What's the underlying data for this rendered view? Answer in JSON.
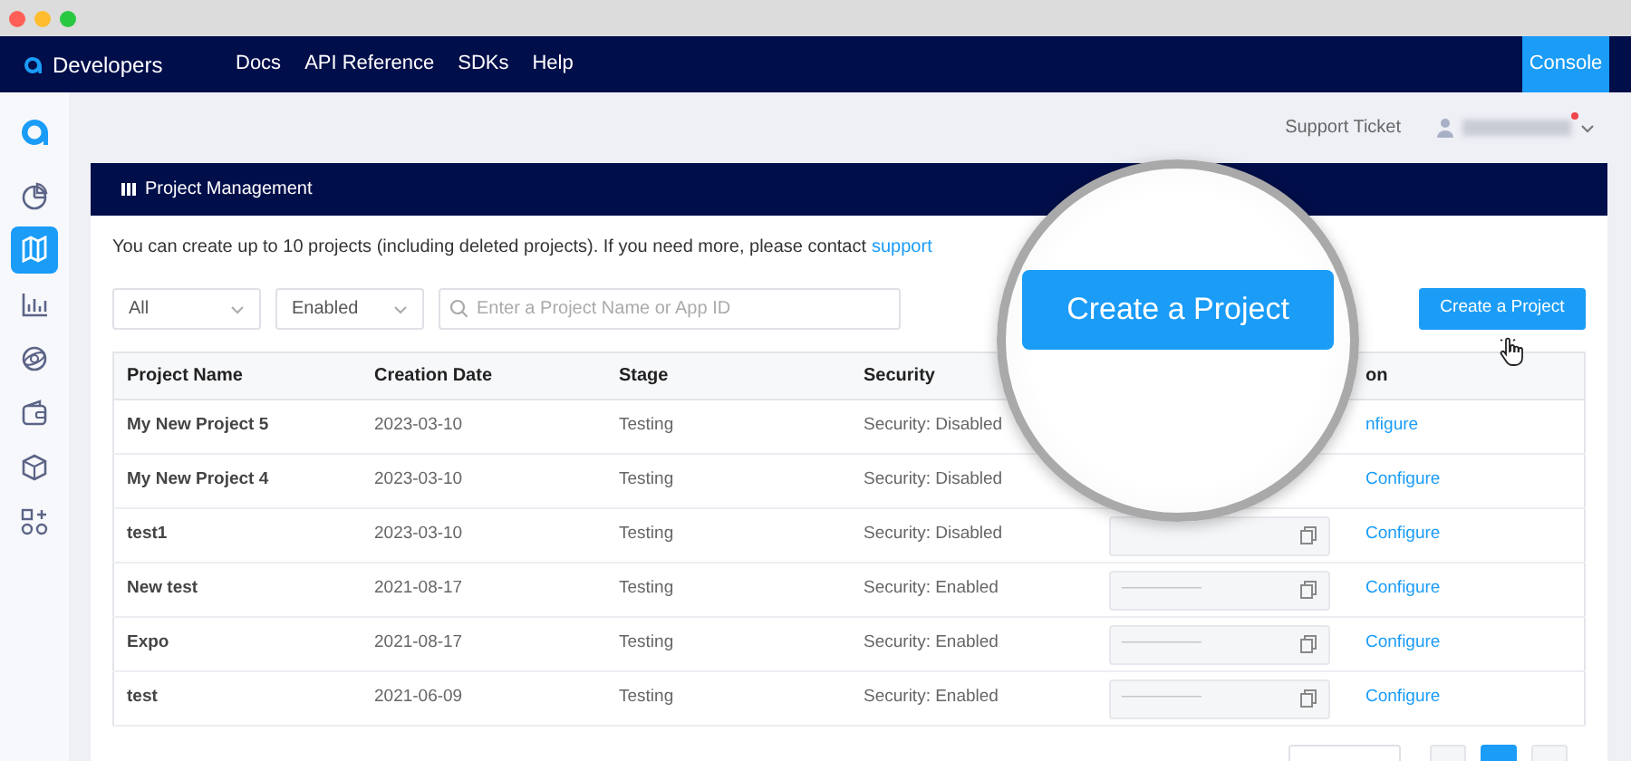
{
  "window": {
    "controls": [
      {
        "color": "#ff5f57"
      },
      {
        "color": "#febc2e"
      },
      {
        "color": "#28c840"
      }
    ]
  },
  "navbar": {
    "brand": "Developers",
    "links": [
      "Docs",
      "API Reference",
      "SDKs",
      "Help"
    ],
    "console": "Console"
  },
  "sidebar": {
    "items": [
      {
        "selected": false
      },
      {
        "selected": true
      },
      {
        "selected": false
      },
      {
        "selected": false
      },
      {
        "selected": false
      },
      {
        "selected": false
      },
      {
        "selected": false
      }
    ]
  },
  "topbar": {
    "support": "Support Ticket",
    "notification": true
  },
  "card": {
    "title": "Project Management",
    "notice": "You can create up to 10 projects (including deleted projects). If you need more, please contact",
    "notice_link": "support",
    "filters": [
      {
        "value": "All"
      },
      {
        "value": "Enabled"
      }
    ],
    "search": {
      "placeholder": "Enter a Project Name or App ID"
    },
    "create_button": "Create a Project",
    "table": {
      "columns": [
        "Project Name",
        "Creation Date",
        "Stage",
        "Security"
      ],
      "action_heading": "on",
      "rows": [
        {
          "name": "My New Project 5",
          "date": "2023-03-10",
          "stage": "Testing",
          "security": "Security: Disabled",
          "action": "nfigure"
        },
        {
          "name": "My New Project 4",
          "date": "2023-03-10",
          "stage": "Testing",
          "security": "Security: Disabled",
          "action": "Configure"
        },
        {
          "name": "test1",
          "date": "2023-03-10",
          "stage": "Testing",
          "security": "Security: Disabled",
          "app_id_field": true,
          "action": "Configure"
        },
        {
          "name": "New test",
          "date": "2021-08-17",
          "stage": "Testing",
          "security": "Security: Enabled",
          "app_id_field": true,
          "app_id": "------------------------------",
          "action": "Configure"
        },
        {
          "name": "Expo",
          "date": "2021-08-17",
          "stage": "Testing",
          "security": "Security: Enabled",
          "app_id_field": true,
          "app_id": "------------------------------",
          "action": "Configure"
        },
        {
          "name": "test",
          "date": "2021-06-09",
          "stage": "Testing",
          "security": "Security: Enabled",
          "app_id_field": true,
          "app_id": "------------------------------",
          "action": "Configure"
        }
      ]
    },
    "pagination": {
      "pages": [
        {
          "selected": true
        }
      ]
    }
  },
  "magnifier": {
    "button": "Create a Project"
  }
}
